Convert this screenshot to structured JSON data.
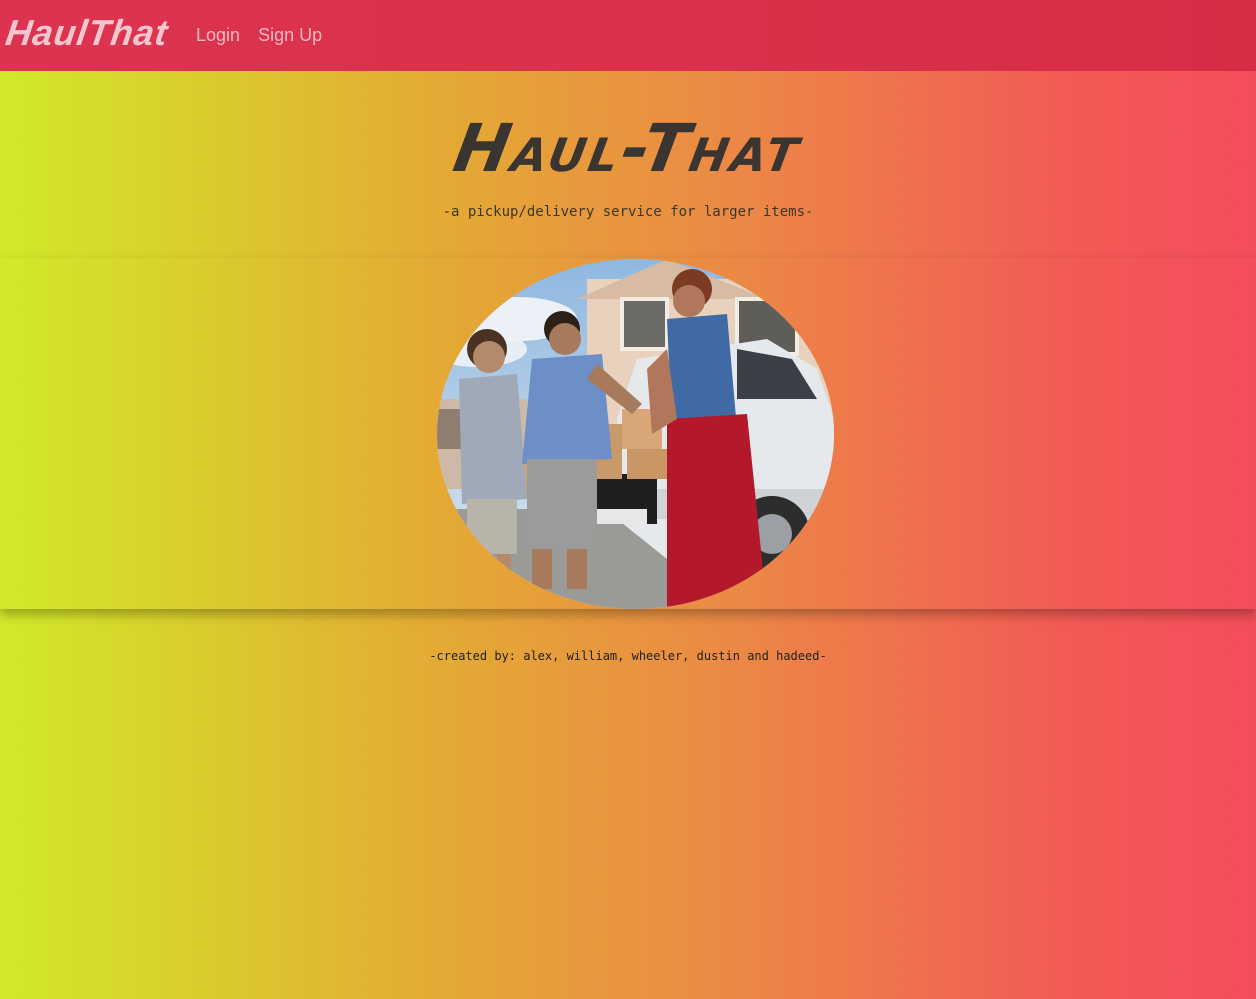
{
  "navbar": {
    "brand": "HaulThat",
    "links": [
      {
        "label": "Login"
      },
      {
        "label": "Sign Up"
      }
    ]
  },
  "hero": {
    "title": "Haul-That",
    "tagline": "-a pickup/delivery service for larger items-"
  },
  "footer": {
    "credits": "-created by: alex, william, wheeler, dustin and hadeed-"
  },
  "colors": {
    "navbar": "#d9304b",
    "gradient_left": "#d1ea28",
    "gradient_right": "#f34d5a",
    "title": "#3a3530"
  }
}
